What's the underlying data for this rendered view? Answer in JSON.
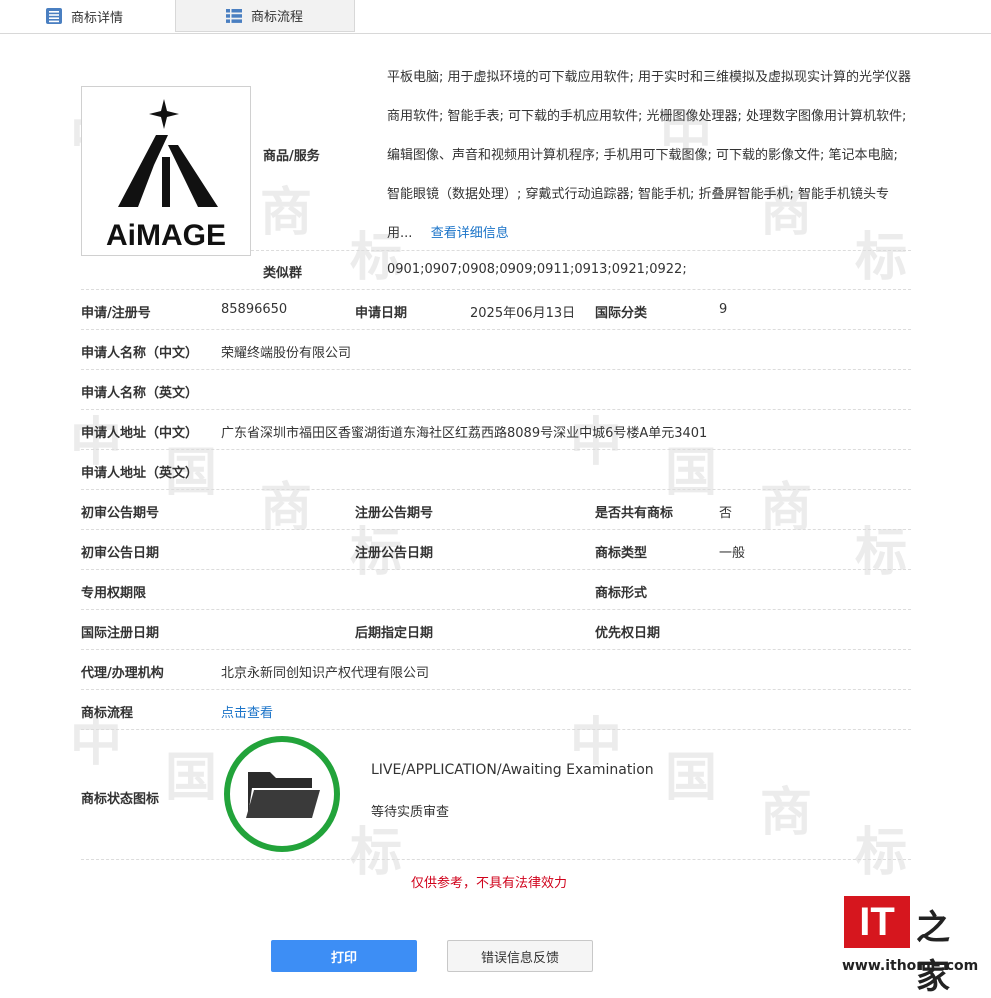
{
  "tabs": [
    {
      "label": "商标详情",
      "active": true,
      "icon": "list-icon"
    },
    {
      "label": "商标流程",
      "active": false,
      "icon": "grid-list-icon"
    }
  ],
  "watermark": {
    "chars": [
      "商",
      "标",
      "中",
      "国"
    ]
  },
  "logo": {
    "text": "AiMAGE"
  },
  "goods": {
    "label": "商品/服务",
    "text": "平板电脑; 用于虚拟环境的可下载应用软件; 用于实时和三维模拟及虚拟现实计算的光学仪器商用软件; 智能手表; 可下载的手机应用软件; 光栅图像处理器; 处理数字图像用计算机软件; 编辑图像、声音和视频用计算机程序; 手机用可下载图像; 可下载的影像文件; 笔记本电脑; 智能眼镜（数据处理）; 穿戴式行动追踪器; 智能手机; 折叠屏智能手机; 智能手机镜头专用...",
    "more_link": "查看详细信息"
  },
  "similar_group": {
    "label": "类似群",
    "value": "0901;0907;0908;0909;0911;0913;0921;0922;"
  },
  "fields": {
    "reg_no_label": "申请/注册号",
    "reg_no": "85896650",
    "apply_date_label": "申请日期",
    "apply_date": "2025年06月13日",
    "intl_class_label": "国际分类",
    "intl_class": "9",
    "applicant_cn_label": "申请人名称（中文）",
    "applicant_cn": "荣耀终端股份有限公司",
    "applicant_en_label": "申请人名称（英文）",
    "applicant_en": "",
    "address_cn_label": "申请人地址（中文）",
    "address_cn": "广东省深圳市福田区香蜜湖街道东海社区红荔西路8089号深业中城6号楼A单元3401",
    "address_en_label": "申请人地址（英文）",
    "address_en": "",
    "prelim_issue_label": "初审公告期号",
    "prelim_issue": "",
    "reg_issue_label": "注册公告期号",
    "reg_issue": "",
    "shared_label": "是否共有商标",
    "shared": "否",
    "prelim_date_label": "初审公告日期",
    "prelim_date": "",
    "reg_date_label": "注册公告日期",
    "reg_date": "",
    "tm_type_label": "商标类型",
    "tm_type": "一般",
    "exclusive_label": "专用权期限",
    "exclusive": "",
    "tm_form_label": "商标形式",
    "tm_form": "",
    "intl_reg_date_label": "国际注册日期",
    "intl_reg_date": "",
    "later_date_label": "后期指定日期",
    "later_date": "",
    "priority_date_label": "优先权日期",
    "priority_date": "",
    "agent_label": "代理/办理机构",
    "agent": "北京永新同创知识产权代理有限公司",
    "flow_label": "商标流程",
    "flow_link": "点击查看"
  },
  "status": {
    "label": "商标状态图标",
    "en": "LIVE/APPLICATION/Awaiting Examination",
    "cn": "等待实质审查",
    "icon": "folder-open-icon",
    "ring_color": "#22a33a"
  },
  "note": "仅供参考，不具有法律效力",
  "buttons": {
    "print": "打印",
    "feedback": "错误信息反馈"
  },
  "brand": {
    "it": "IT",
    "zhi": "之家",
    "url": "www.ithome.com",
    "color": "#d6161e"
  }
}
